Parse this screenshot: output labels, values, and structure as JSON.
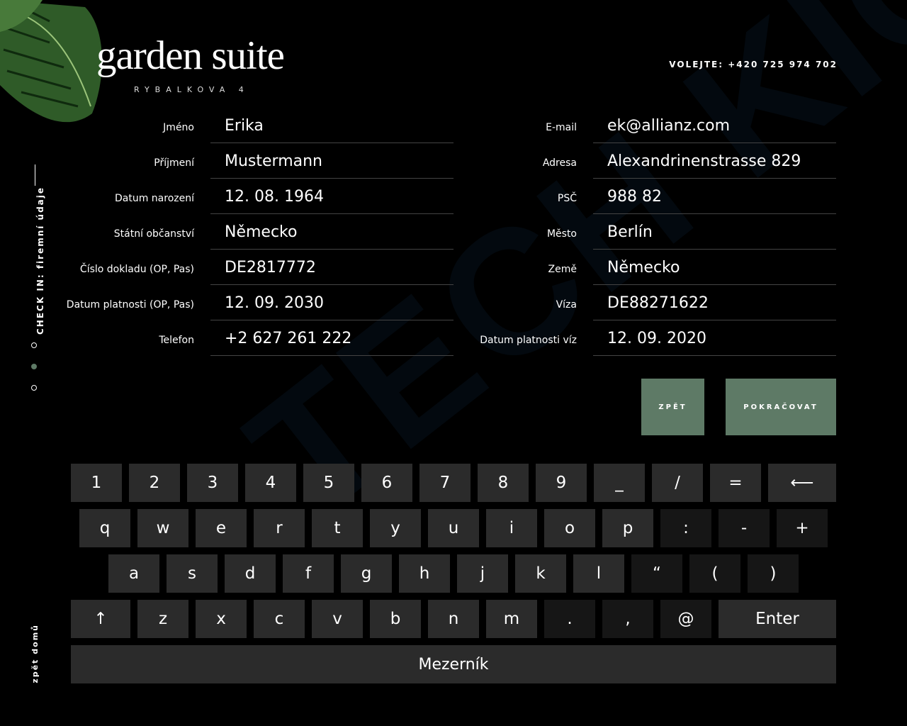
{
  "brand": {
    "title": "garden suite",
    "subtitle": "RYBALKOVA 4"
  },
  "header": {
    "phone": "VOLEJTE: +420 725 974 702"
  },
  "sidebar": {
    "step_label": "CHECK IN: firemní údaje",
    "home": "zpět domů"
  },
  "watermark": "TECH KIOSK",
  "form_left": [
    {
      "label": "Jméno",
      "value": "Erika"
    },
    {
      "label": "Příjmení",
      "value": "Mustermann"
    },
    {
      "label": "Datum narození",
      "value": "12. 08. 1964"
    },
    {
      "label": "Státní občanství",
      "value": "Německo"
    },
    {
      "label": "Číslo dokladu (OP, Pas)",
      "value": "DE2817772"
    },
    {
      "label": "Datum platnosti (OP, Pas)",
      "value": "12. 09. 2030"
    },
    {
      "label": "Telefon",
      "value": "+2 627 261 222"
    }
  ],
  "form_right": [
    {
      "label": "E-mail",
      "value": "ek@allianz.com"
    },
    {
      "label": "Adresa",
      "value": "Alexandrinenstrasse 829"
    },
    {
      "label": "PSČ",
      "value": "988 82"
    },
    {
      "label": "Město",
      "value": "Berlín"
    },
    {
      "label": "Země",
      "value": "Německo"
    },
    {
      "label": "Víza",
      "value": "DE88271622"
    },
    {
      "label": "Datum platnosti víz",
      "value": "12. 09. 2020"
    }
  ],
  "buttons": {
    "back": "ZPĚT",
    "continue": "POKRAČOVAT"
  },
  "keyboard": {
    "row1": [
      "1",
      "2",
      "3",
      "4",
      "5",
      "6",
      "7",
      "8",
      "9",
      "_",
      "/",
      "=",
      "⟵"
    ],
    "row2": [
      "q",
      "w",
      "e",
      "r",
      "t",
      "y",
      "u",
      "i",
      "o",
      "p",
      ":",
      "-",
      "+"
    ],
    "row3": [
      "a",
      "s",
      "d",
      "f",
      "g",
      "h",
      "j",
      "k",
      "l",
      "“",
      "(",
      ")"
    ],
    "row4": [
      "↑",
      "z",
      "x",
      "c",
      "v",
      "b",
      "n",
      "m",
      ".",
      ",",
      "@",
      "Enter"
    ],
    "space": "Mezerník"
  }
}
